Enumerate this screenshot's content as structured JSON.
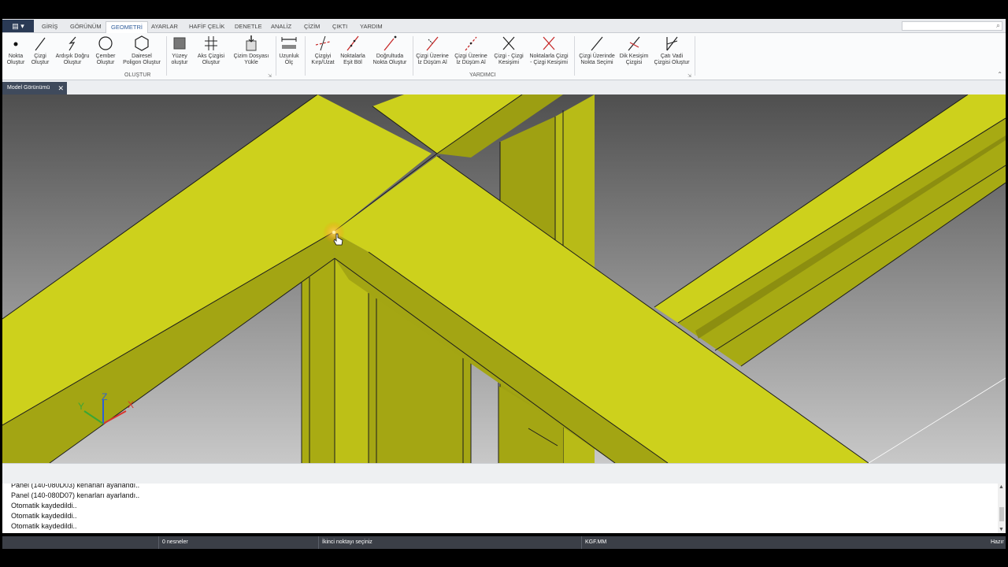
{
  "app_button": {
    "label": "▤ ▾"
  },
  "ribbon_tabs": [
    {
      "label": "GİRİŞ"
    },
    {
      "label": "GÖRÜNÜM"
    },
    {
      "label": "GEOMETRİ",
      "active": true
    },
    {
      "label": "AYARLAR"
    },
    {
      "label": "HAFİF ÇELİK"
    },
    {
      "label": "DENETLE"
    },
    {
      "label": "ANALİZ"
    },
    {
      "label": "ÇİZİM"
    },
    {
      "label": "ÇIKTI"
    },
    {
      "label": "YARDIM"
    }
  ],
  "search": {
    "placeholder": "",
    "icon": "search-icon"
  },
  "ribbon": {
    "group_olustur": "OLUŞTUR",
    "group_yardimci": "YARDIMCI",
    "buttons": [
      {
        "label": "Nokta\nOluştur",
        "icon": "point-icon"
      },
      {
        "label": "Çizgi\nOluştur",
        "icon": "line-icon"
      },
      {
        "label": "Ardışık Doğru\nOluştur",
        "icon": "polyline-icon"
      },
      {
        "label": "Çember\nOluştur",
        "icon": "circle-icon"
      },
      {
        "label": "Dairesel\nPoligon Oluştur",
        "icon": "hexagon-icon"
      },
      {
        "label": "Yüzey\noluştur",
        "icon": "surface-icon"
      },
      {
        "label": "Aks Çizgisi\nOluştur",
        "icon": "axis-grid-icon"
      },
      {
        "label": "Çizim Dosyası\nYükle",
        "icon": "load-drawing-icon"
      },
      {
        "label": "Uzunluk\nÖlç",
        "icon": "measure-icon"
      },
      {
        "label": "Çizgiyi\nKırp/Uzat",
        "icon": "trim-extend-icon"
      },
      {
        "label": "Noktalarla\nEşit Böl",
        "icon": "divide-icon"
      },
      {
        "label": "Doğrultuda\nNokta Oluştur",
        "icon": "direction-point-icon"
      },
      {
        "label": "Çizgi Üzerine\nİz Düşüm Al",
        "icon": "project-line-icon"
      },
      {
        "label": "Çizgi Üzerine\nİz Düşüm Al",
        "icon": "project-line-icon"
      },
      {
        "label": "Çizgi - Çizgi\nKesişimi",
        "icon": "intersection-icon"
      },
      {
        "label": "Noktalarla Çizgi\n- Çizgi Kesişimi",
        "icon": "point-intersection-icon"
      },
      {
        "label": "Çizgi Üzerinde\nNokta Seçimi",
        "icon": "point-on-line-icon"
      },
      {
        "label": "Dik Kesişim\nÇizgisi",
        "icon": "perpendicular-icon"
      },
      {
        "label": "Çatı Vadi\nÇizgisi Oluştur",
        "icon": "valley-line-icon"
      }
    ]
  },
  "doc_tab": {
    "label": "Model Görünümü",
    "close": "✕"
  },
  "axes": {
    "x": "X",
    "y": "Y",
    "z": "Z"
  },
  "log_lines": [
    "Panel (140-080D03) kenarları ayarlandı..",
    "Panel (140-080D07) kenarları ayarlandı..",
    "Otomatik kaydedildi..",
    "Otomatik kaydedildi..",
    "Otomatik kaydedildi.."
  ],
  "status": {
    "selection": "0 nesneler",
    "prompt": "İkinci noktayı seçiniz",
    "units": "KGF.MM",
    "ready": "Hazır"
  },
  "colors": {
    "member_top": "#cdd11c",
    "member_side": "#a5a713",
    "member_dark": "#8f9011",
    "accent": "#2e5c9a"
  }
}
